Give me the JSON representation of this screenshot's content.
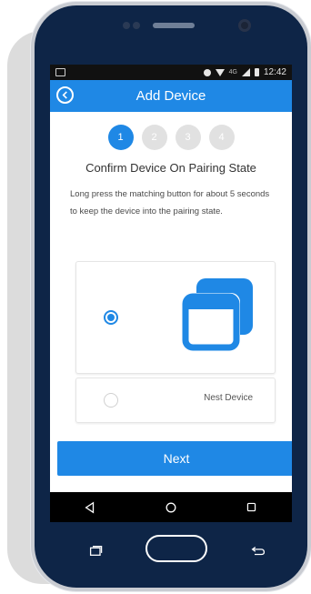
{
  "status_bar": {
    "network": "4G",
    "time": "12:42"
  },
  "app_bar": {
    "title": "Add Device",
    "back_icon": "chevron-left-circle-icon"
  },
  "steps": [
    "1",
    "2",
    "3",
    "4"
  ],
  "active_step": 0,
  "content": {
    "heading": "Confirm Device On Pairing State",
    "description": "Long press the matching button for about 5 seconds to keep the device into the pairing state."
  },
  "options": [
    {
      "label": "",
      "icon": "device-window-icon",
      "selected": true
    },
    {
      "label": "Nest Device",
      "selected": false
    }
  ],
  "next_button": {
    "label": "Next"
  },
  "colors": {
    "accent": "#1f88e5",
    "phone_body": "#0e2547",
    "step_inactive": "#e1e1e1"
  },
  "nav_icons": [
    "back-triangle-icon",
    "home-circle-icon",
    "recents-square-icon"
  ]
}
